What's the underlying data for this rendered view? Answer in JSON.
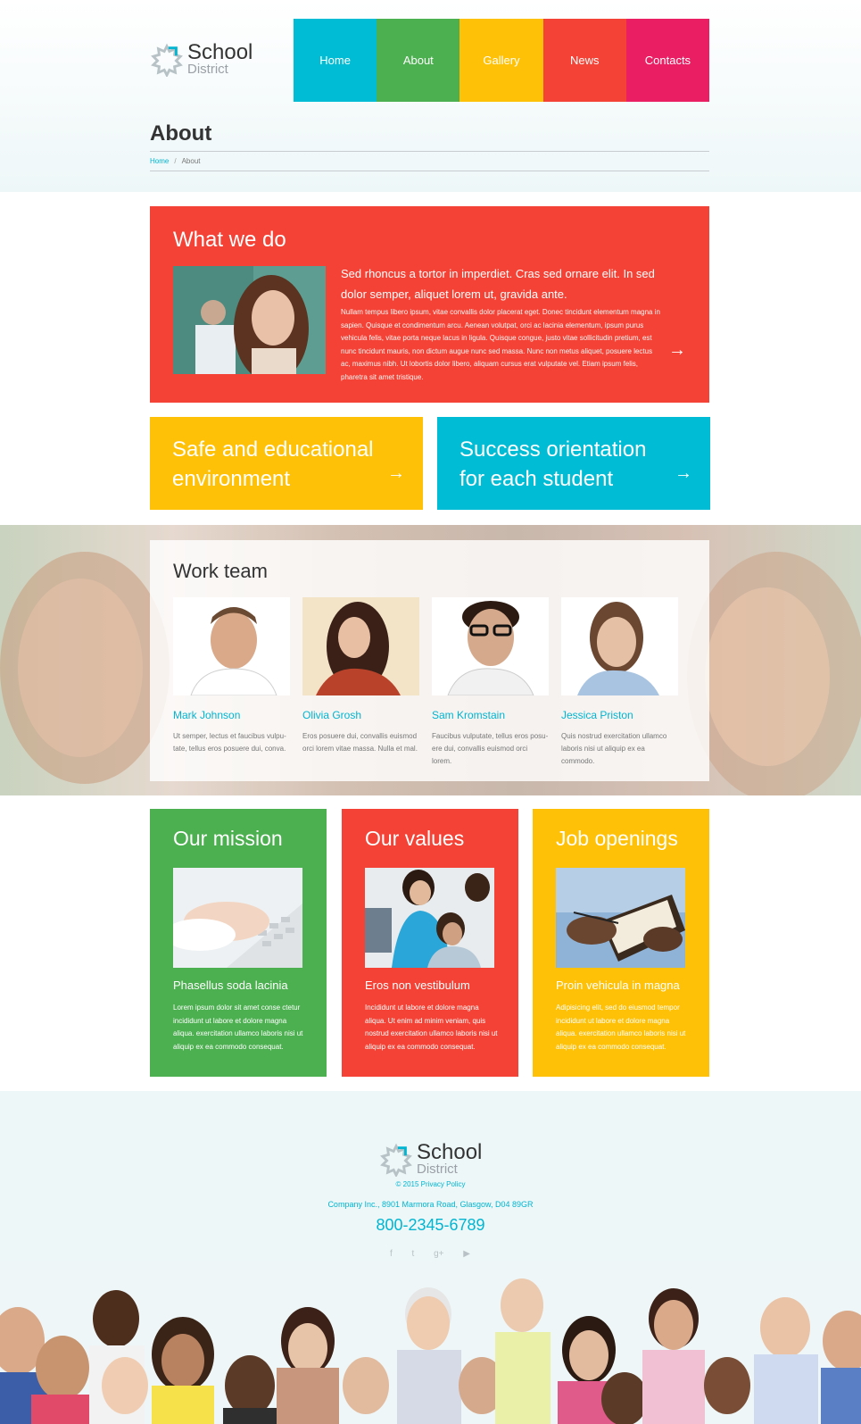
{
  "logo": {
    "title": "School",
    "subtitle": "District"
  },
  "nav": [
    {
      "label": "Home",
      "color": "#00bcd4"
    },
    {
      "label": "About",
      "color": "#4caf50"
    },
    {
      "label": "Gallery",
      "color": "#ffc107"
    },
    {
      "label": "News",
      "color": "#f44336"
    },
    {
      "label": "Contacts",
      "color": "#e91e63"
    }
  ],
  "page": {
    "title": "About"
  },
  "breadcrumb": {
    "home": "Home",
    "separator": "/",
    "current": "About"
  },
  "what_we_do": {
    "title": "What we do",
    "lead": "Sed rhoncus a tortor in imperdiet. Cras sed ornare elit. In sed dolor semper, aliquet lorem ut, gravida ante.",
    "body": "Nullam tempus libero ipsum, vitae convallis dolor placerat eget. Donec tincidunt elementum magna in sapien. Quisque et condimentum arcu. Aenean volutpat, orci ac lacinia elementum, ipsum purus vehicula felis, vitae porta neque lacus in ligula. Quisque congue, justo vitae sollicitudin pretium, est nunc tincidunt mauris, non dictum augue nunc sed massa. Nunc non metus aliquet, posuere lectus ac, maximus nibh. Ut lobortis dolor libero, aliquam cursus erat vulputate vel. Etiam ipsum felis, pharetra sit amet tristique.",
    "arrow_icon": "arrow-right-icon"
  },
  "tiles": [
    {
      "label": "Safe and educational environment",
      "color": "#ffc107"
    },
    {
      "label": "Success orientation for each student",
      "color": "#00bcd4"
    }
  ],
  "team": {
    "title": "Work team",
    "members": [
      {
        "name": "Mark Johnson",
        "desc": "Ut semper, lectus et faucibus vulpu-tate, tellus eros posuere dui, conva."
      },
      {
        "name": "Olivia Grosh",
        "desc": "Eros posuere dui, convallis euismod orci lorem vitae massa. Nulla et mal."
      },
      {
        "name": "Sam Kromstain",
        "desc": "Faucibus vulputate, tellus eros posu-ere dui, convallis euismod orci lorem."
      },
      {
        "name": "Jessica Priston",
        "desc": "Quis nostrud exercitation ullamco laboris nisi ut aliquip ex ea commodo."
      }
    ]
  },
  "cards": [
    {
      "title": "Our mission",
      "sub": "Phasellus soda lacinia",
      "text": "Lorem ipsum dolor sit amet conse ctetur incididunt ut labore et dolore magna aliqua. exercitation ullamco laboris nisi ut aliquip ex ea commodo consequat.",
      "color": "#4caf50"
    },
    {
      "title": "Our values",
      "sub": "Eros non vestibulum",
      "text": "Incididunt ut labore et dolore magna aliqua. Ut enim ad minim veniam, quis nostrud exercitation ullamco laboris nisi ut aliquip ex ea commodo consequat.",
      "color": "#f44336"
    },
    {
      "title": "Job openings",
      "sub": "Proin vehicula in magna",
      "text": "Adipisicing elit, sed do eiusmod tempor incididunt ut labore et dolore magna aliqua. exercitation ullamco laboris nisi ut aliquip ex ea commodo consequat.",
      "color": "#ffc107"
    }
  ],
  "footer": {
    "logo_title": "School",
    "logo_subtitle": "District",
    "copyright": "© 2015 Privacy Policy",
    "address": "Company Inc., 8901 Marmora Road,  Glasgow, D04 89GR",
    "phone": "800-2345-6789",
    "social": [
      "facebook-icon",
      "twitter-icon",
      "google-plus-icon",
      "youtube-icon"
    ]
  }
}
